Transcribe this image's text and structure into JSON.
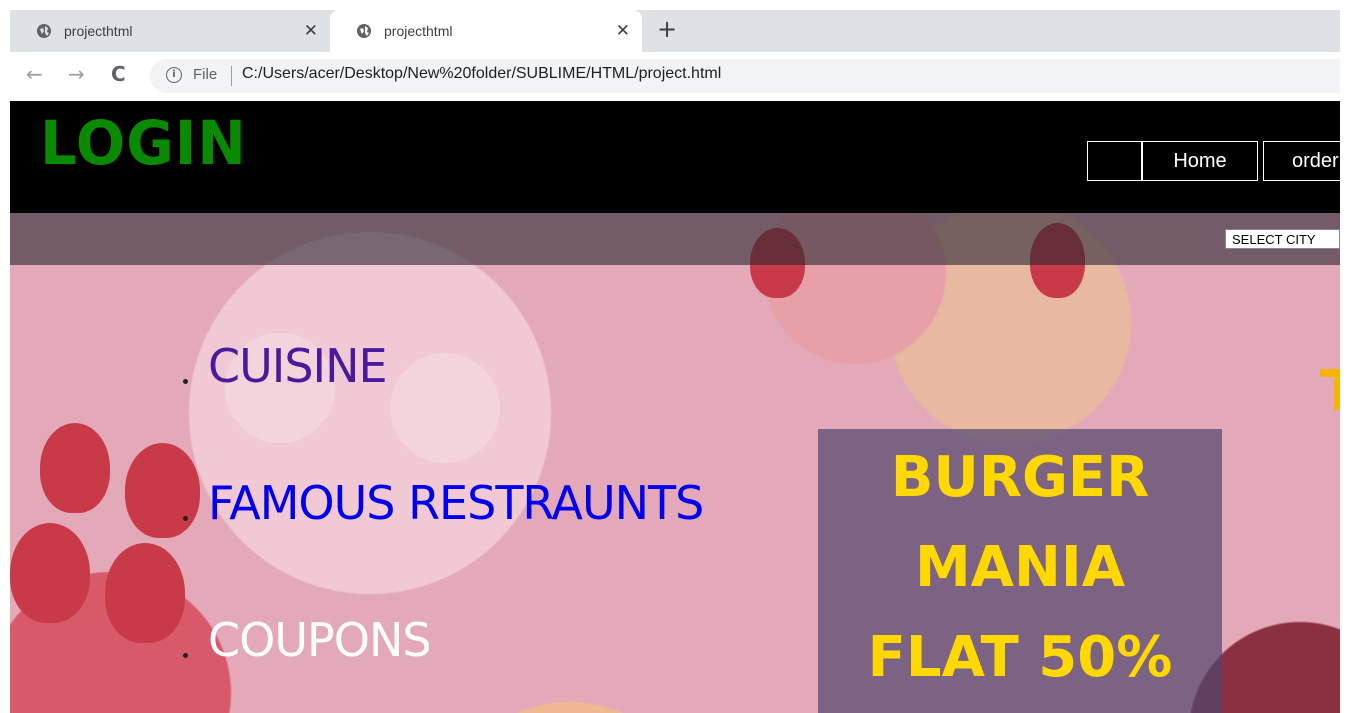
{
  "browser": {
    "tabs": [
      {
        "title": "projecthtml",
        "close": "✕"
      },
      {
        "title": "projecthtml",
        "close": "✕"
      }
    ],
    "new_tab": "+",
    "back": "←",
    "forward": "→",
    "reload": "C",
    "info": "i",
    "scheme_label": "File",
    "url": "C:/Users/acer/Desktop/New%20folder/SUBLIME/HTML/project.html"
  },
  "header": {
    "logo": "LOGIN",
    "nav": [
      "",
      "Home",
      "order"
    ]
  },
  "city_select": "SELECT CITY",
  "menu": [
    "CUISINE",
    "FAMOUS RESTRAUNTS",
    "COUPONS"
  ],
  "offer": [
    "BURGER",
    "MANIA",
    "FLAT 50%"
  ],
  "edge_text": "T",
  "colors": {
    "logo": "#0a8a00",
    "menu_cuisine": "#4a1a9c",
    "menu_restaurants": "#0000ee",
    "menu_coupons": "#ffffff",
    "offer_text": "#ffd800",
    "header_bg": "#000000"
  }
}
